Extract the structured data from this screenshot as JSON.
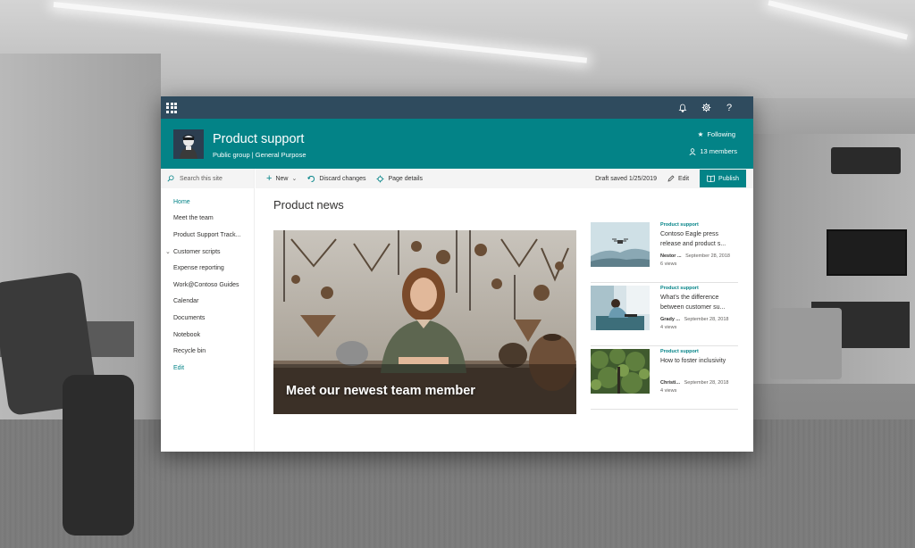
{
  "suite": {
    "icons": [
      "app-launcher-icon",
      "bell-icon",
      "gear-icon",
      "help-icon"
    ],
    "help_label": "?"
  },
  "site": {
    "title": "Product support",
    "subtitle": "Public group | General Purpose",
    "following_label": "Following",
    "members_label": "13 members",
    "accent_color": "#038387",
    "suitebar_color": "#2f4b5e"
  },
  "leftnav": {
    "search_placeholder": "Search this site",
    "items": [
      {
        "label": "Home",
        "active": true
      },
      {
        "label": "Meet the team"
      },
      {
        "label": "Product Support Track..."
      },
      {
        "label": "Customer scripts",
        "expandable": true
      },
      {
        "label": "Expense reporting"
      },
      {
        "label": "Work@Contoso Guides"
      },
      {
        "label": "Calendar"
      },
      {
        "label": "Documents"
      },
      {
        "label": "Notebook"
      },
      {
        "label": "Recycle bin"
      }
    ],
    "edit_label": "Edit"
  },
  "cmdbar": {
    "new_label": "New",
    "discard_label": "Discard changes",
    "details_label": "Page details",
    "draft_status": "Draft saved 1/25/2019",
    "edit_label": "Edit",
    "publish_label": "Publish"
  },
  "news": {
    "section_title": "Product news",
    "hero_caption": "Meet our newest team member",
    "cards": [
      {
        "category": "Product support",
        "title": "Contoso Eagle press release and product s...",
        "author": "Nestor ...",
        "date": "September 28, 2018",
        "views": "6 views"
      },
      {
        "category": "Product support",
        "title": "What's the difference between customer su...",
        "author": "Grady ...",
        "date": "September 28, 2018",
        "views": "4 views"
      },
      {
        "category": "Product support",
        "title": "How to foster inclusivity",
        "author": "Christi...",
        "date": "September 28, 2018",
        "views": "4 views"
      }
    ]
  }
}
